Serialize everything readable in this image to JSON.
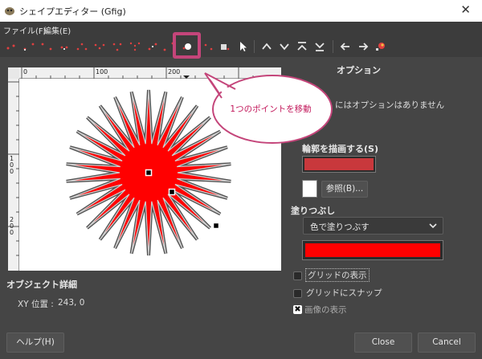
{
  "window": {
    "title": "シェイプエディター (Gfig)",
    "close_glyph": "✕"
  },
  "menubar": {
    "file": "ファイル(F)",
    "edit": "編集(E)"
  },
  "toolbar": {
    "icons": [
      "create-point-icon",
      "create-line-icon",
      "create-rectangle-icon",
      "create-circle-icon",
      "create-ellipse-icon",
      "create-arc-icon",
      "create-polygon-icon",
      "create-star-icon",
      "create-spiral-icon",
      "create-bezier-icon",
      "move-object-icon",
      "move-point-icon",
      "copy-object-icon",
      "delete-object-icon",
      "select-object-icon",
      "raise-icon",
      "lower-icon",
      "to-top-icon",
      "to-bottom-icon",
      "previous-icon",
      "next-icon",
      "show-all-icon"
    ]
  },
  "callout": {
    "text": "1つのポイントを移動"
  },
  "ruler": {
    "top_labels": [
      "0",
      "100",
      "200"
    ],
    "left_labels": [
      "1\n0\n0",
      "2\n0\n0"
    ]
  },
  "object_details": {
    "title": "オブジェクト詳細",
    "xy_label": "XY 位置 :",
    "xy_value": "243, 0"
  },
  "options": {
    "title_visible": "オプション",
    "info_visible": "にはオプションはありません"
  },
  "stroke": {
    "label": "輪郭を描画する(S)",
    "color": "#c8383c",
    "brush_button": "参照(B)..."
  },
  "fill": {
    "label": "塗りつぶし",
    "dropdown_value": "色で塗りつぶす",
    "color": "#ff0000"
  },
  "checkboxes": [
    {
      "label": "グリッドの表示",
      "checked": false
    },
    {
      "label": "グリッドにスナップ",
      "checked": false
    },
    {
      "label": "画像の表示",
      "checked": true
    }
  ],
  "buttons": {
    "help": "ヘルプ(H)",
    "close": "Close",
    "cancel": "Cancel"
  }
}
